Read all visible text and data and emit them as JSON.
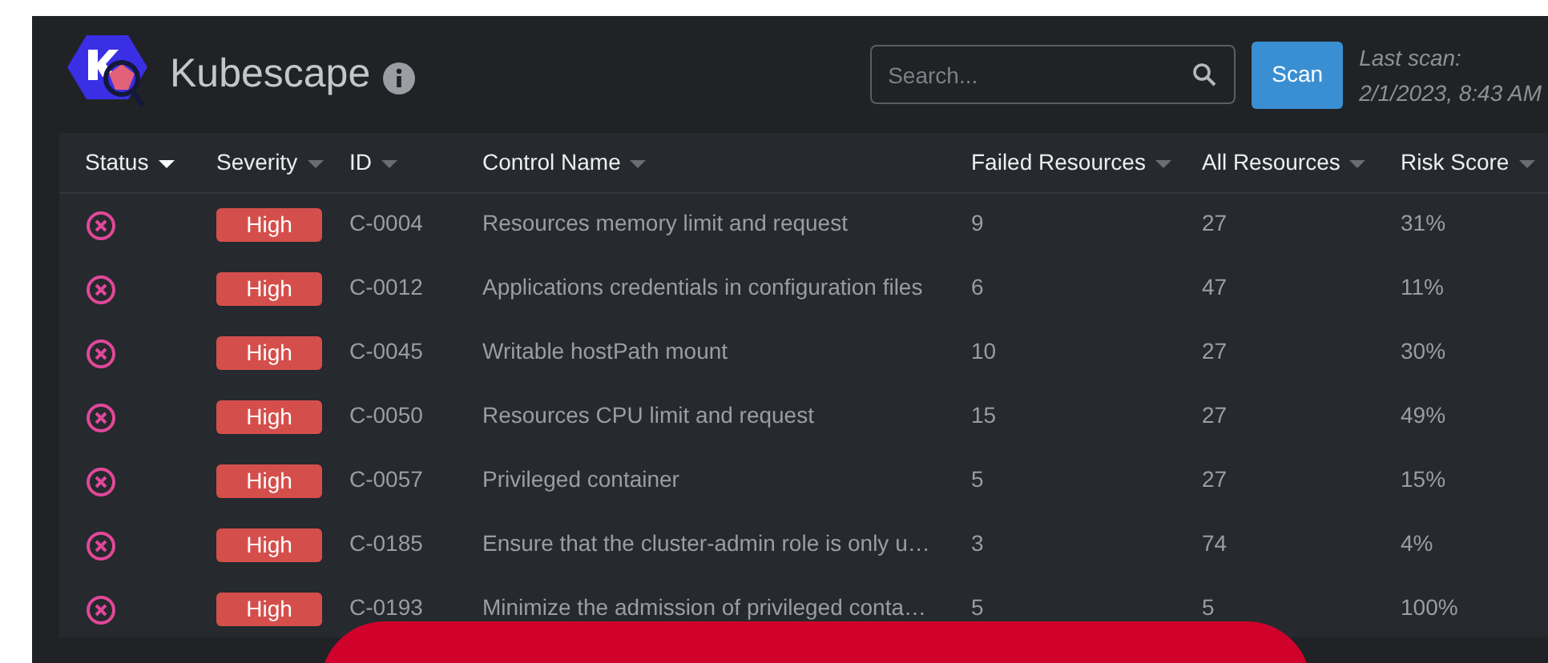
{
  "header": {
    "title": "Kubescape",
    "search": {
      "placeholder": "Search..."
    },
    "scan_button": "Scan",
    "last_scan_label": "Last scan:",
    "last_scan_time": "2/1/2023, 8:43 AM"
  },
  "table": {
    "columns": [
      {
        "label": "Status",
        "sorted": true
      },
      {
        "label": "Severity",
        "sorted": false
      },
      {
        "label": "ID",
        "sorted": false
      },
      {
        "label": "Control Name",
        "sorted": false
      },
      {
        "label": "Failed Resources",
        "sorted": false
      },
      {
        "label": "All Resources",
        "sorted": false
      },
      {
        "label": "Risk Score",
        "sorted": false
      }
    ],
    "rows": [
      {
        "failed_status": true,
        "severity": "High",
        "id": "C-0004",
        "name": "Resources memory limit and request",
        "failed": "9",
        "all": "27",
        "risk": "31%"
      },
      {
        "failed_status": true,
        "severity": "High",
        "id": "C-0012",
        "name": "Applications credentials in configuration files",
        "failed": "6",
        "all": "47",
        "risk": "11%"
      },
      {
        "failed_status": true,
        "severity": "High",
        "id": "C-0045",
        "name": "Writable hostPath mount",
        "failed": "10",
        "all": "27",
        "risk": "30%"
      },
      {
        "failed_status": true,
        "severity": "High",
        "id": "C-0050",
        "name": "Resources CPU limit and request",
        "failed": "15",
        "all": "27",
        "risk": "49%"
      },
      {
        "failed_status": true,
        "severity": "High",
        "id": "C-0057",
        "name": "Privileged container",
        "failed": "5",
        "all": "27",
        "risk": "15%"
      },
      {
        "failed_status": true,
        "severity": "High",
        "id": "C-0185",
        "name": "Ensure that the cluster-admin role is only u…",
        "failed": "3",
        "all": "74",
        "risk": "4%"
      },
      {
        "failed_status": true,
        "severity": "High",
        "id": "C-0193",
        "name": "Minimize the admission of privileged conta…",
        "failed": "5",
        "all": "5",
        "risk": "100%"
      }
    ]
  }
}
